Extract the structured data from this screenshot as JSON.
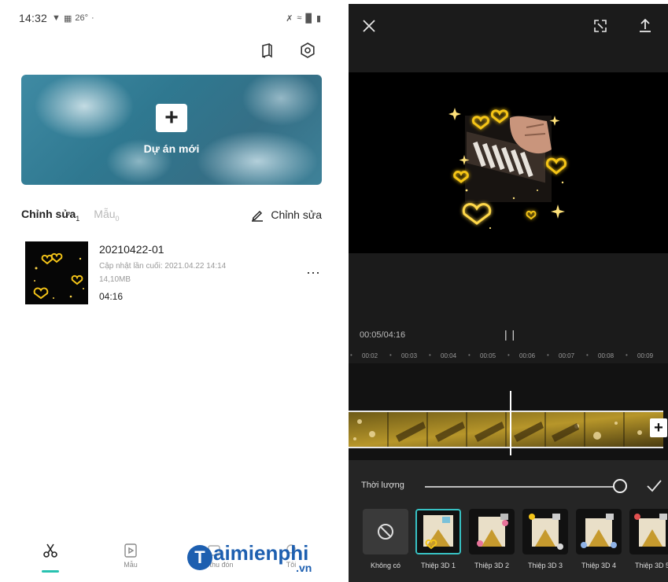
{
  "left_screen": {
    "status": {
      "time": "14:32",
      "temperature": "26°",
      "left_icons": [
        "notification-icon",
        "gallery-icon"
      ],
      "right_icons": [
        "mute-icon",
        "wifi-icon",
        "signal-icon",
        "signal-icon",
        "battery-icon"
      ]
    },
    "top_icons": [
      "tutorial-book-icon",
      "settings-gear-icon"
    ],
    "hero": {
      "label": "Dự án mới",
      "icon": "plus-icon"
    },
    "tabs": {
      "active_label": "Chỉnh sửa",
      "active_count": "1",
      "muted_label": "Mẫu",
      "muted_count": "0",
      "edit_label": "Chỉnh sửa"
    },
    "project": {
      "name": "20210422-01",
      "updated": "Cập nhật lần cuối: 2021.04.22 14:14",
      "size": "14,10MB",
      "duration": "04:16",
      "more": "⋯"
    },
    "bottom_nav": [
      {
        "label": "",
        "icon": "scissors-icon"
      },
      {
        "label": "Mẫu",
        "icon": "template-icon"
      },
      {
        "label": "Thư thu đón",
        "icon": "inbox-icon"
      },
      {
        "label": "Tôi",
        "icon": "profile-icon"
      }
    ],
    "watermark": {
      "brand": "aimienphi",
      "initial": "T",
      "suffix": ".vn"
    }
  },
  "right_screen": {
    "top_icons": [
      "close-icon",
      "fullscreen-icon",
      "export-icon"
    ],
    "timecode": "00:05/04:16",
    "pause_glyph": "| |",
    "ruler": [
      "00:02",
      "00:03",
      "00:04",
      "00:05",
      "00:06",
      "00:07",
      "00:08",
      "00:09"
    ],
    "add_clip": "+",
    "duration_panel": {
      "label": "Thời lượng",
      "slider_fraction": 1.0
    },
    "effects": [
      {
        "label": "Không có",
        "selected": false
      },
      {
        "label": "Thiệp 3D 1",
        "selected": true
      },
      {
        "label": "Thiệp 3D 2",
        "selected": false
      },
      {
        "label": "Thiệp 3D 3",
        "selected": false
      },
      {
        "label": "Thiệp 3D 4",
        "selected": false
      },
      {
        "label": "Thiệp 3D 5",
        "selected": false
      }
    ],
    "colors": {
      "accent": "#37c1c3",
      "heart_gold": "#f5c518",
      "heart_glow": "#ffd84a",
      "nav_accent": "#28c2b0"
    }
  }
}
